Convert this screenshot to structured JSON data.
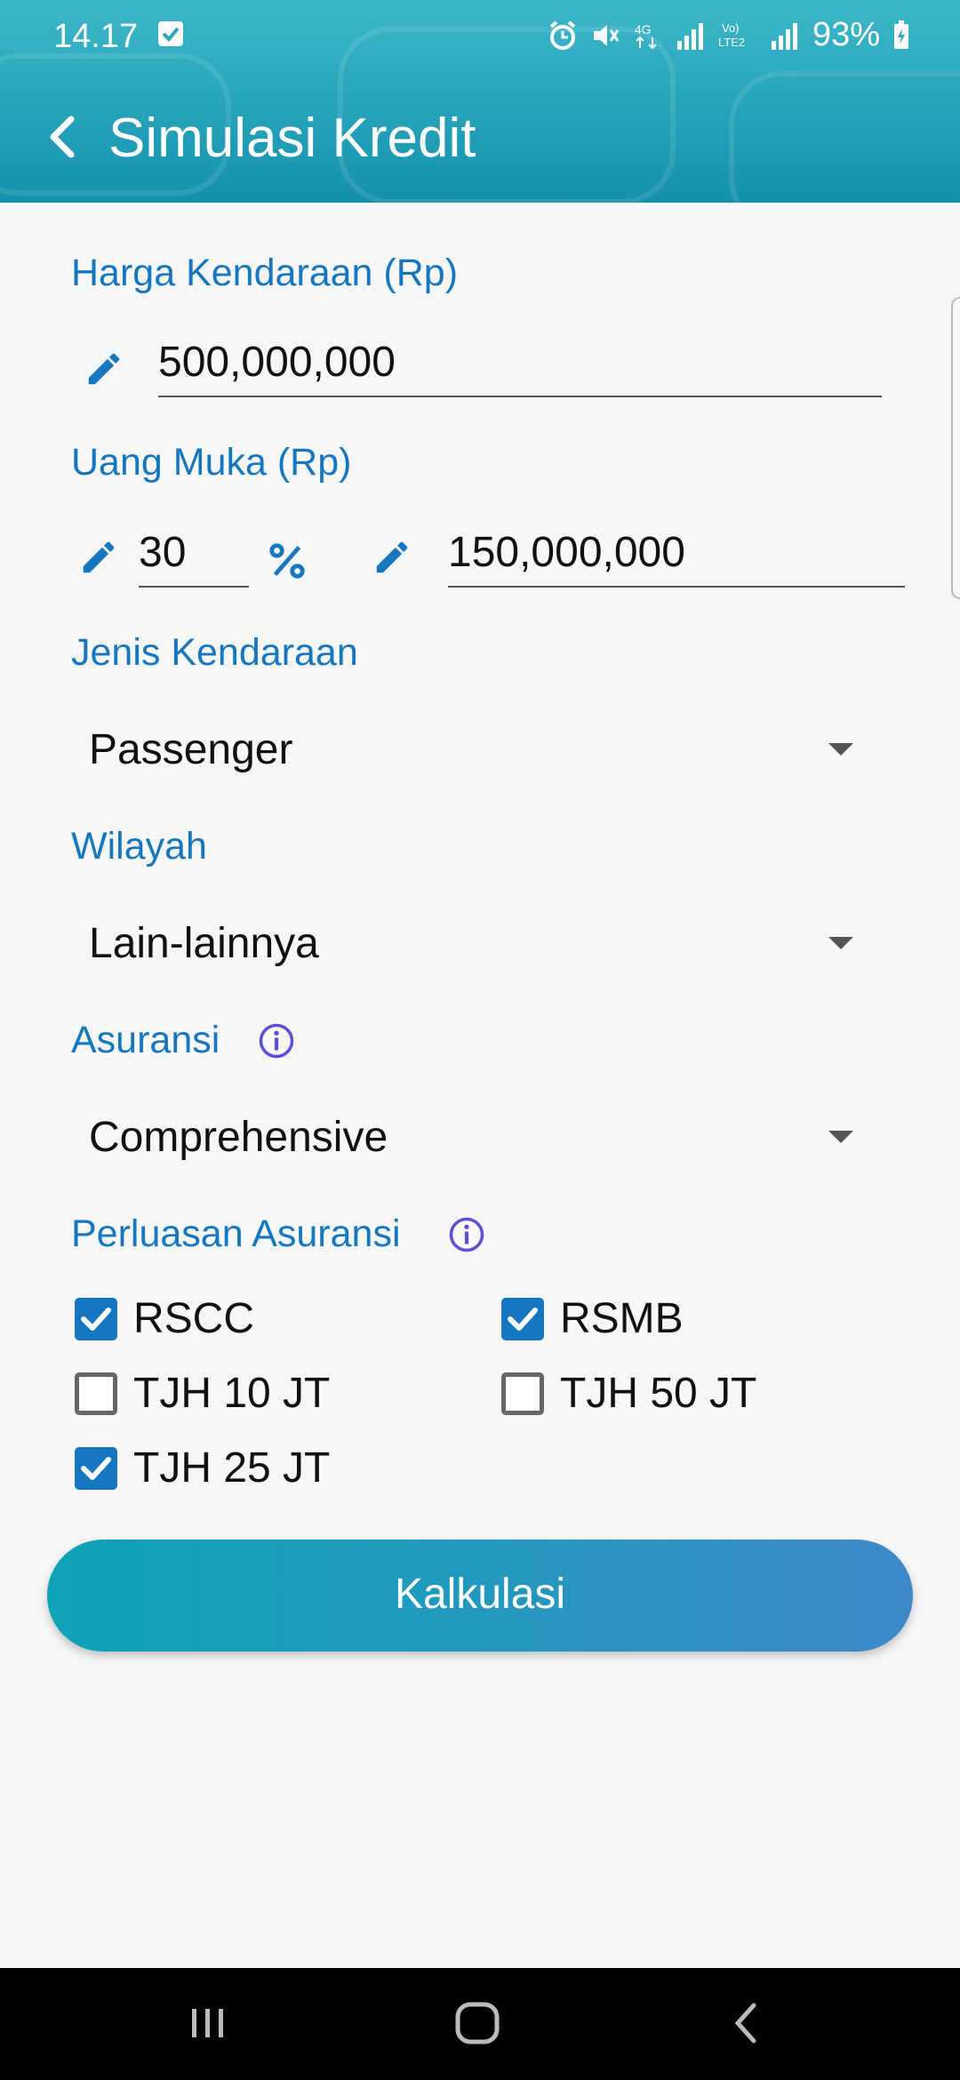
{
  "status_bar": {
    "time": "14.17",
    "battery": "93%",
    "icons": [
      "check-square-icon",
      "alarm-icon",
      "mute-icon",
      "4g-icon",
      "signal-icon",
      "volte-lte2-icon",
      "signal-icon",
      "battery-charging-icon"
    ]
  },
  "header": {
    "title": "Simulasi Kredit",
    "back_icon": "back-arrow-icon"
  },
  "form": {
    "vehicle_price": {
      "label": "Harga Kendaraan (Rp)",
      "value": "500,000,000"
    },
    "down_payment": {
      "label": "Uang Muka (Rp)",
      "percent_value": "30",
      "percent_symbol_icon": "percent-icon",
      "amount_value": "150,000,000"
    },
    "vehicle_type": {
      "label": "Jenis Kendaraan",
      "selected": "Passenger"
    },
    "region": {
      "label": "Wilayah",
      "selected": "Lain-lainnya"
    },
    "insurance": {
      "label": "Asuransi",
      "selected": "Comprehensive",
      "info_icon": "info-icon"
    },
    "insurance_extension": {
      "label": "Perluasan Asuransi",
      "info_icon": "info-icon",
      "options": [
        {
          "label": "RSCC",
          "checked": true
        },
        {
          "label": "RSMB",
          "checked": true
        },
        {
          "label": "TJH 10 JT",
          "checked": false
        },
        {
          "label": "TJH 50 JT",
          "checked": false
        },
        {
          "label": "TJH 25 JT",
          "checked": true
        }
      ]
    },
    "calculate_button": "Kalkulasi"
  },
  "colors": {
    "header": "#2aa7bd",
    "label": "#1577bf",
    "checkbox_checked": "#1577bf",
    "info_icon": "#5b4fd6",
    "button_start": "#0ea2b8",
    "button_end": "#3e88c8",
    "background": "#f7f7f7",
    "nav_bar": "#000000"
  },
  "nav_bar": {
    "icons": [
      "recent-apps-icon",
      "home-icon",
      "back-icon"
    ]
  }
}
